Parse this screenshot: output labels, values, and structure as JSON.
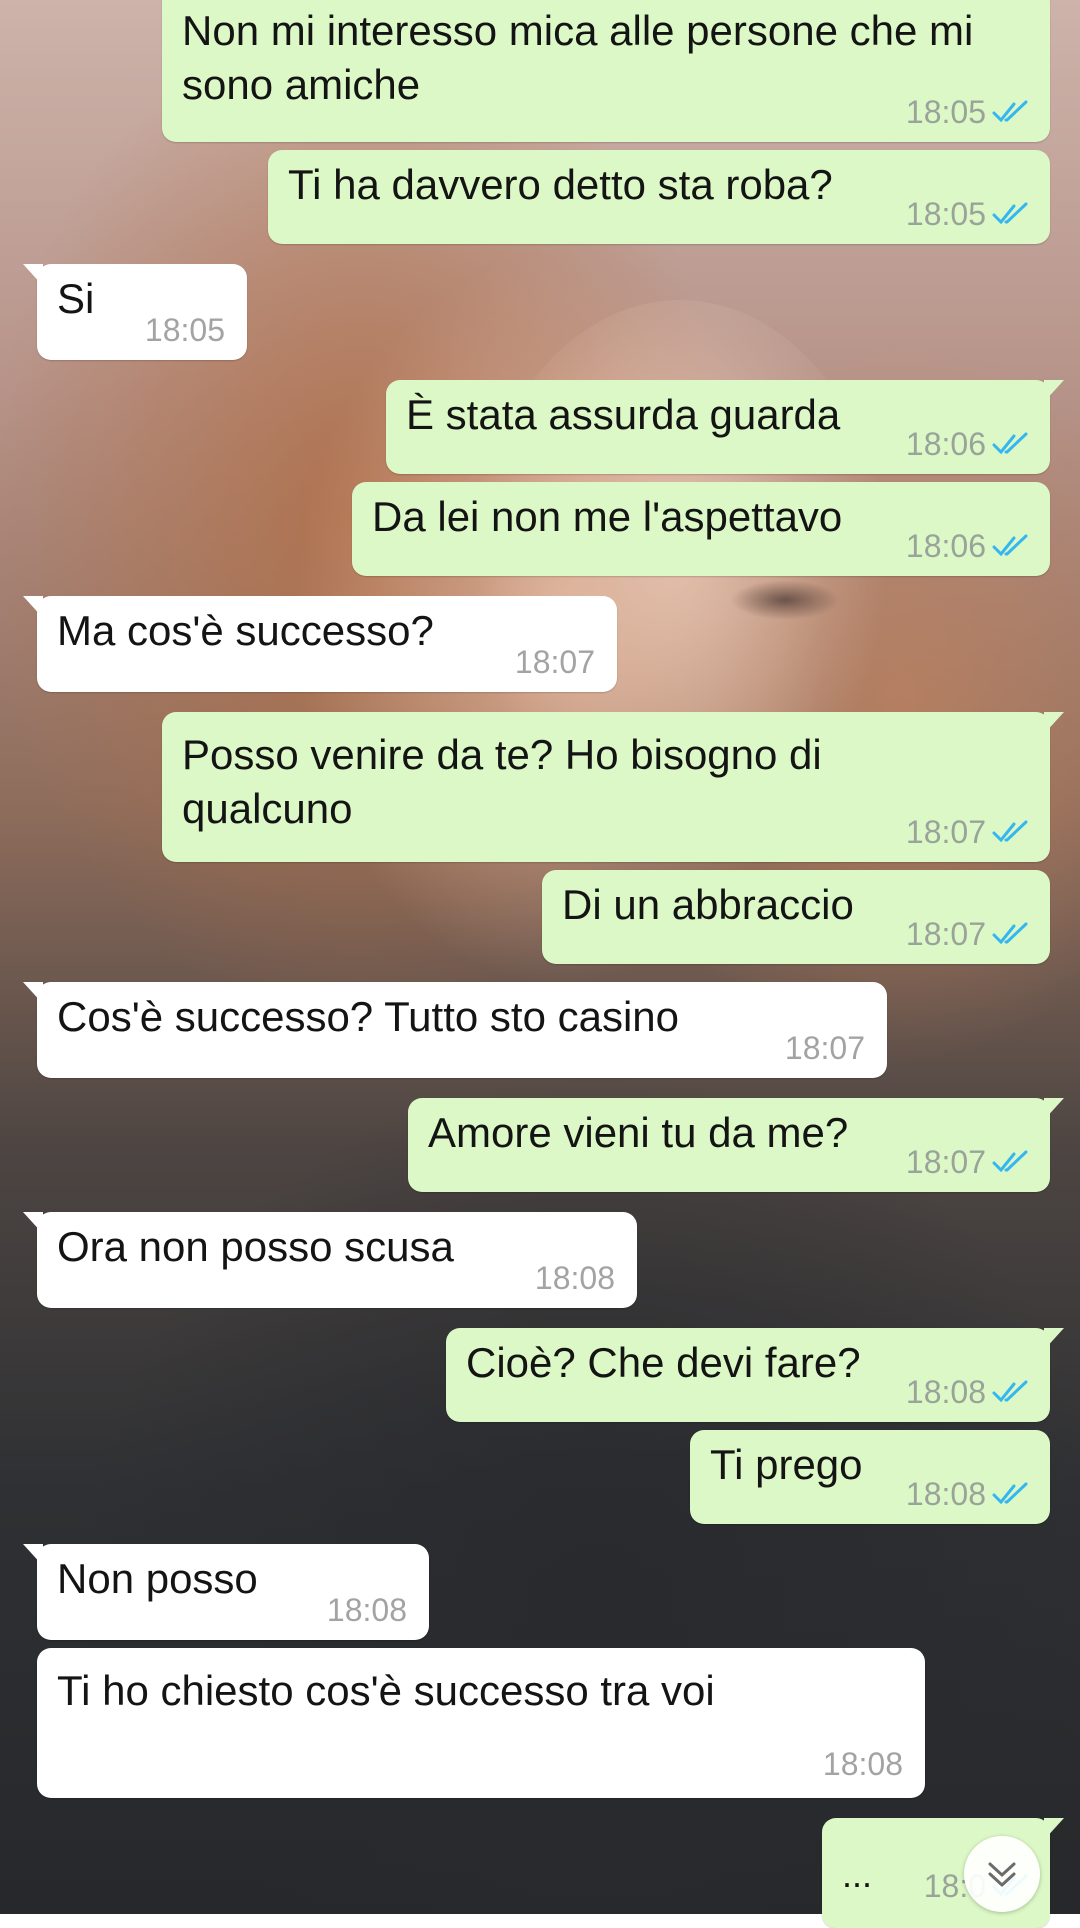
{
  "messages": [
    {
      "direction": "out",
      "text": "Non mi interesso mica alle persone che mi sono amiche",
      "time": "18:05",
      "status": "read"
    },
    {
      "direction": "out",
      "text": "Ti ha davvero detto sta roba?",
      "time": "18:05",
      "status": "read"
    },
    {
      "direction": "in",
      "text": "Si",
      "time": "18:05"
    },
    {
      "direction": "out",
      "text": "È stata assurda guarda",
      "time": "18:06",
      "status": "read"
    },
    {
      "direction": "out",
      "text": "Da lei non me l'aspettavo",
      "time": "18:06",
      "status": "read"
    },
    {
      "direction": "in",
      "text": "Ma cos'è successo?",
      "time": "18:07"
    },
    {
      "direction": "out",
      "text": "Posso venire da te? Ho bisogno di qualcuno",
      "time": "18:07",
      "status": "read"
    },
    {
      "direction": "out",
      "text": "Di un abbraccio",
      "time": "18:07",
      "status": "read"
    },
    {
      "direction": "in",
      "text": "Cos'è successo? Tutto sto casino",
      "time": "18:07"
    },
    {
      "direction": "out",
      "text": "Amore vieni tu da me?",
      "time": "18:07",
      "status": "read"
    },
    {
      "direction": "in",
      "text": "Ora non posso scusa",
      "time": "18:08"
    },
    {
      "direction": "out",
      "text": "Cioè? Che devi fare?",
      "time": "18:08",
      "status": "read"
    },
    {
      "direction": "out",
      "text": "Ti prego",
      "time": "18:08",
      "status": "read"
    },
    {
      "direction": "in",
      "text": "Non posso",
      "time": "18:08"
    },
    {
      "direction": "in",
      "text": "Ti ho chiesto cos'è successo tra voi",
      "time": "18:08"
    },
    {
      "direction": "out",
      "text": "...",
      "time": "18:0",
      "status": "read"
    }
  ],
  "colors": {
    "outgoing_bubble": "#dcf8c6",
    "incoming_bubble": "#ffffff",
    "read_ticks": "#34b7f1",
    "timestamp": "#9aa39a"
  },
  "icons": {
    "read_status": "double-check-icon",
    "scroll_down": "double-chevron-down-icon"
  }
}
